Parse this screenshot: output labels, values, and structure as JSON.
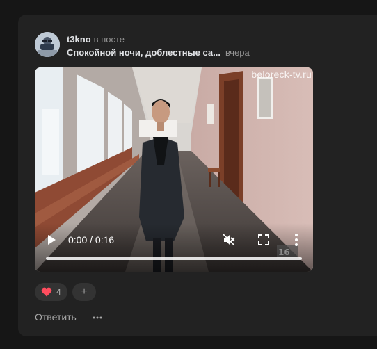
{
  "post": {
    "author": "t3kno",
    "in_post_label": "в посте",
    "title": "Спокойной ночи, доблестные са...",
    "time": "вчера"
  },
  "video": {
    "watermark": "beloreck-tv.ru",
    "time_display": "0:00 / 0:16",
    "progress": 0
  },
  "reactions": {
    "heart_count": "4",
    "add_label": "+"
  },
  "actions": {
    "reply_label": "Ответить",
    "more_label": "···"
  },
  "colors": {
    "background": "#161616",
    "card": "#222222",
    "heart": "#ff4d5e"
  }
}
